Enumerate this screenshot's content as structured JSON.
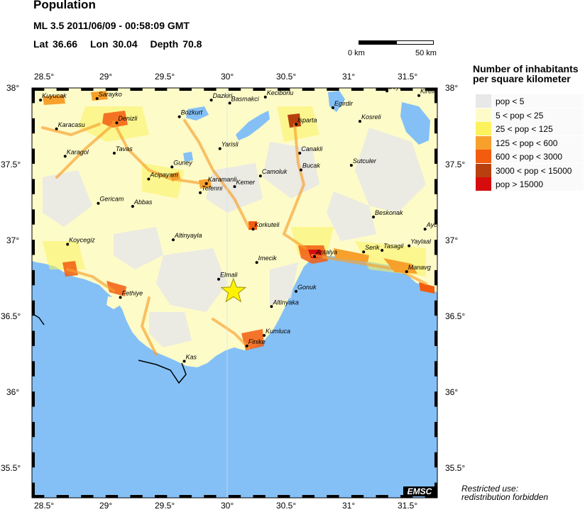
{
  "header": {
    "title": "Population",
    "event": "ML 3.5  2011/06/09 - 00:58:09 GMT",
    "lat_label": "Lat",
    "lat_value": "36.66",
    "lon_label": "Lon",
    "lon_value": "30.04",
    "depth_label": "Depth",
    "depth_value": "70.8"
  },
  "scale": {
    "left_label": "0 km",
    "right_label": "50 km"
  },
  "axes": {
    "lon_ticks": [
      "28.5°",
      "29°",
      "29.5°",
      "30°",
      "30.5°",
      "31°",
      "31.5°"
    ],
    "lat_ticks": [
      "38°",
      "37.5°",
      "37°",
      "36.5°",
      "36°",
      "35.5°"
    ]
  },
  "legend": {
    "title_line1": "Number of inhabitants",
    "title_line2": "per square kilometer",
    "items": [
      {
        "label": "pop < 5",
        "color": "#e8e8e8"
      },
      {
        "label": "5 < pop < 25",
        "color": "#fdfbc8"
      },
      {
        "label": "25 < pop < 125",
        "color": "#fbf25e"
      },
      {
        "label": "125 < pop < 600",
        "color": "#f7a02c"
      },
      {
        "label": "600 < pop < 3000",
        "color": "#f25c0f"
      },
      {
        "label": "3000 < pop < 15000",
        "color": "#b8400f"
      },
      {
        "label": "pop > 15000",
        "color": "#d70d0d"
      }
    ]
  },
  "colors": {
    "sea": "#84c0f6",
    "land_base": "#fdfbc8",
    "epicenter": "#fff200"
  },
  "epicenter": {
    "lat": 36.66,
    "lon": 30.04
  },
  "cities": [
    {
      "name": "Kuyucak",
      "lat": 37.92,
      "lon": 28.47
    },
    {
      "name": "Sarayko",
      "lat": 37.93,
      "lon": 28.93
    },
    {
      "name": "Denizli",
      "lat": 37.77,
      "lon": 29.09
    },
    {
      "name": "Karacasu",
      "lat": 37.73,
      "lon": 28.6
    },
    {
      "name": "Bozkurt",
      "lat": 37.81,
      "lon": 29.6
    },
    {
      "name": "Dazkiri",
      "lat": 37.92,
      "lon": 29.86
    },
    {
      "name": "Basmakci",
      "lat": 37.9,
      "lon": 30.01
    },
    {
      "name": "Keciborlu",
      "lat": 37.94,
      "lon": 30.3
    },
    {
      "name": "Egirdir",
      "lat": 37.87,
      "lon": 30.85
    },
    {
      "name": "Isparta",
      "lat": 37.76,
      "lon": 30.55
    },
    {
      "name": "Kosreli",
      "lat": 37.78,
      "lon": 31.07
    },
    {
      "name": "Kireli",
      "lat": 37.95,
      "lon": 31.55
    },
    {
      "name": "Beysehir",
      "lat": 37.98,
      "lon": 31.29
    },
    {
      "name": "Tavas",
      "lat": 37.57,
      "lon": 29.07
    },
    {
      "name": "Karagol",
      "lat": 37.55,
      "lon": 28.67
    },
    {
      "name": "Yarisli",
      "lat": 37.6,
      "lon": 29.93
    },
    {
      "name": "Canakli",
      "lat": 37.57,
      "lon": 30.58
    },
    {
      "name": "Sutculer",
      "lat": 37.49,
      "lon": 31.0
    },
    {
      "name": "Guney",
      "lat": 37.48,
      "lon": 29.54
    },
    {
      "name": "Acipayam",
      "lat": 37.4,
      "lon": 29.35
    },
    {
      "name": "Karamanli",
      "lat": 37.37,
      "lon": 29.82
    },
    {
      "name": "Tefenni",
      "lat": 37.31,
      "lon": 29.77
    },
    {
      "name": "Kemer",
      "lat": 37.35,
      "lon": 30.05
    },
    {
      "name": "Camoluk",
      "lat": 37.42,
      "lon": 30.26
    },
    {
      "name": "Bucak",
      "lat": 37.46,
      "lon": 30.59
    },
    {
      "name": "Gericam",
      "lat": 37.24,
      "lon": 28.94
    },
    {
      "name": "Abbas",
      "lat": 37.22,
      "lon": 29.22
    },
    {
      "name": "Beskonak",
      "lat": 37.15,
      "lon": 31.18
    },
    {
      "name": "Korkuteli",
      "lat": 37.07,
      "lon": 30.2
    },
    {
      "name": "Ayc",
      "lat": 37.07,
      "lon": 31.6
    },
    {
      "name": "Altinyayla",
      "lat": 37.0,
      "lon": 29.55
    },
    {
      "name": "Koycegiz",
      "lat": 36.97,
      "lon": 28.69
    },
    {
      "name": "Yaylaal",
      "lat": 36.96,
      "lon": 31.47
    },
    {
      "name": "Serik",
      "lat": 36.92,
      "lon": 31.1
    },
    {
      "name": "Tasagil",
      "lat": 36.93,
      "lon": 31.25
    },
    {
      "name": "Antalya",
      "lat": 36.89,
      "lon": 30.7
    },
    {
      "name": "Imecik",
      "lat": 36.85,
      "lon": 30.23
    },
    {
      "name": "Manavg",
      "lat": 36.79,
      "lon": 31.45
    },
    {
      "name": "Elmali",
      "lat": 36.74,
      "lon": 29.92
    },
    {
      "name": "Gonuk",
      "lat": 36.66,
      "lon": 30.55
    },
    {
      "name": "Fethiye",
      "lat": 36.62,
      "lon": 29.12
    },
    {
      "name": "Altinyaka",
      "lat": 36.56,
      "lon": 30.35
    },
    {
      "name": "Kumluca",
      "lat": 36.37,
      "lon": 30.29
    },
    {
      "name": "Finike",
      "lat": 36.3,
      "lon": 30.15
    },
    {
      "name": "Kas",
      "lat": 36.2,
      "lon": 29.64
    }
  ]
}
